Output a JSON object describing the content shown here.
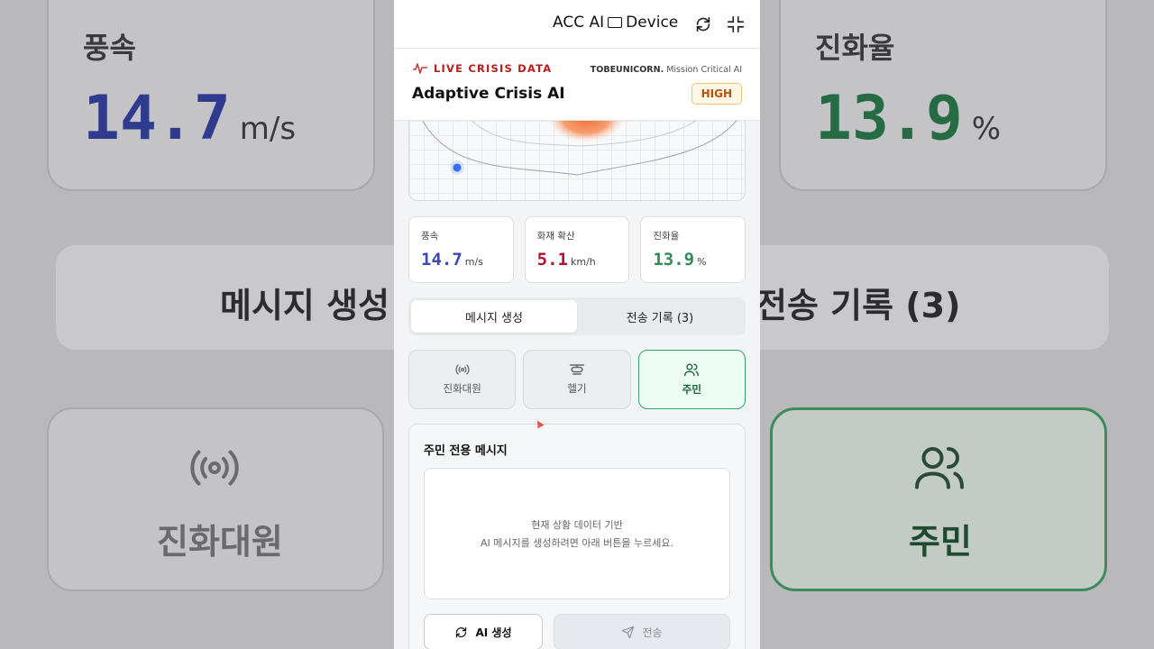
{
  "background": {
    "stat_left": {
      "label": "풍속",
      "value": "14.7",
      "unit": "m/s"
    },
    "stat_right": {
      "label": "진화율",
      "value": "13.9",
      "unit": "%"
    },
    "tab_left": "메시지 생성",
    "tab_right": "전송 기록 (3)",
    "role_left": "진화대원",
    "role_right": "주민"
  },
  "topbar": {
    "title_prefix": "ACC AI",
    "title_suffix": "Device",
    "icons": [
      "rotate-icon",
      "exit-fullscreen-icon"
    ]
  },
  "header": {
    "live_label": "LIVE CRISIS DATA",
    "app_title": "Adaptive Crisis AI",
    "brand_name": "TOBEUNICORN.",
    "brand_tagline": "Mission Critical AI",
    "risk_level": "HIGH"
  },
  "stats": [
    {
      "label": "풍속",
      "value": "14.7",
      "unit": "m/s",
      "color": "#3b4bb5"
    },
    {
      "label": "화재 확산",
      "value": "5.1",
      "unit": "km/h",
      "color": "#b3122e"
    },
    {
      "label": "진화율",
      "value": "13.9",
      "unit": "%",
      "color": "#2f8a55"
    }
  ],
  "tabs": [
    {
      "label": "메시지 생성",
      "active": true
    },
    {
      "label": "전송 기록 (3)",
      "active": false
    }
  ],
  "roles": [
    {
      "label": "진화대원",
      "icon": "radio-broadcast-icon",
      "active": false
    },
    {
      "label": "헬기",
      "icon": "helicopter-icon",
      "active": false
    },
    {
      "label": "주민",
      "icon": "users-icon",
      "active": true
    }
  ],
  "message": {
    "title": "주민 전용 메시지",
    "placeholder_line1": "현재 상황 데이터 기반",
    "placeholder_line2": "AI 메시지를 생성하려면 아래 버튼을 누르세요.",
    "generate_label": "AI 생성",
    "send_label": "전송"
  },
  "colors": {
    "accent_green": "#35a56a",
    "risk_orange": "#b45309",
    "live_red": "#b91c1c"
  }
}
